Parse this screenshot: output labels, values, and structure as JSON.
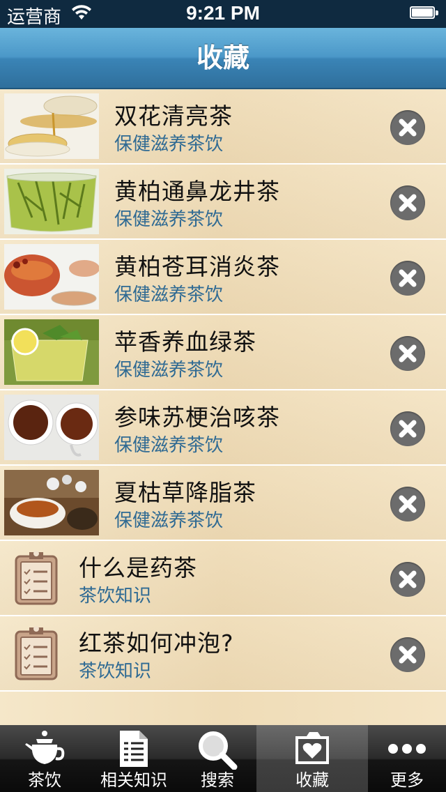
{
  "status_bar": {
    "carrier": "运营商",
    "time": "9:21 PM"
  },
  "nav": {
    "title": "收藏"
  },
  "favorites": [
    {
      "title": "双花清亮茶",
      "subtitle": "保健滋养茶饮"
    },
    {
      "title": "黄柏通鼻龙井茶",
      "subtitle": "保健滋养茶饮"
    },
    {
      "title": "黄柏苍耳消炎茶",
      "subtitle": "保健滋养茶饮"
    },
    {
      "title": "苹香养血绿茶",
      "subtitle": "保健滋养茶饮"
    },
    {
      "title": "参味苏梗治咳茶",
      "subtitle": "保健滋养茶饮"
    },
    {
      "title": "夏枯草降脂茶",
      "subtitle": "保健滋养茶饮"
    },
    {
      "title": "什么是药茶",
      "subtitle": "茶饮知识"
    },
    {
      "title": "红茶如何冲泡?",
      "subtitle": "茶饮知识"
    }
  ],
  "tabs": [
    {
      "label": "茶饮",
      "icon": "teapot-icon"
    },
    {
      "label": "相关知识",
      "icon": "document-icon"
    },
    {
      "label": "搜索",
      "icon": "magnifier-icon"
    },
    {
      "label": "收藏",
      "icon": "favorites-folder-icon",
      "selected": true
    },
    {
      "label": "更多",
      "icon": "more-dots-icon"
    }
  ],
  "colors": {
    "nav_blue": "#4b98c8",
    "subtitle_blue": "#2f6a93",
    "delete_gray": "#6c6c6c",
    "list_bg": "#f2e2c2"
  }
}
